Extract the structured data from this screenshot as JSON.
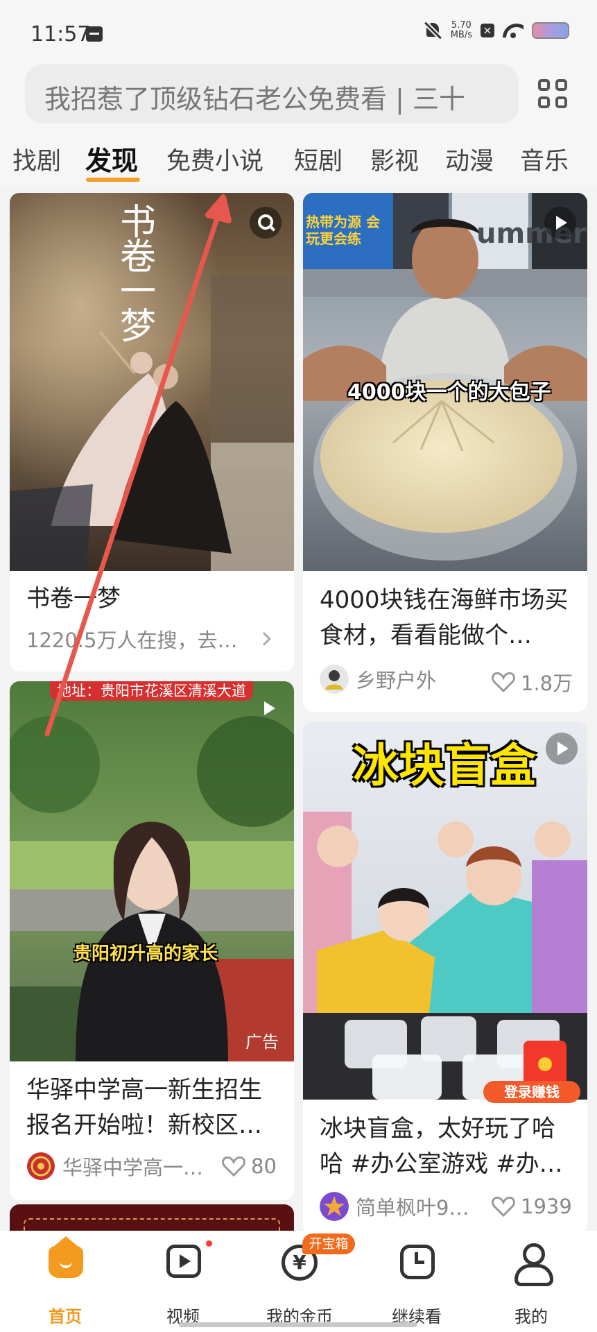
{
  "status_bar": {
    "time": "11:57",
    "net_speed_value": "5.70",
    "net_speed_unit": "MB/s",
    "icons": [
      "message-icon",
      "mute-icon",
      "x-icon",
      "wifi-icon",
      "battery-icon"
    ]
  },
  "search": {
    "placeholder": "我招惹了顶级钻石老公免费看 | 三十"
  },
  "tabs": [
    {
      "label": "找剧"
    },
    {
      "label": "发现"
    },
    {
      "label": "免费小说"
    },
    {
      "label": "短剧"
    },
    {
      "label": "影视"
    },
    {
      "label": "动漫"
    },
    {
      "label": "音乐"
    }
  ],
  "active_tab": "发现",
  "feed": {
    "card1": {
      "poster_title": "书卷一梦",
      "title": "书卷一梦",
      "subtitle": "1220.5万人在搜，去…"
    },
    "card2": {
      "caption": "4000块一个的大包子",
      "banner_text": "热带为源 会玩更会练",
      "sign_text": "ummer",
      "title": "4000块钱在海鲜市场买食材，看看能做个…",
      "author": "乡野户外",
      "likes": "1.8万"
    },
    "card3": {
      "top_banner": "地址：贵阳市花溪区清溪大道",
      "caption": "贵阳初升高的家长",
      "ad_label": "广告",
      "title": "华驿中学高一新生招生报名开始啦！新校区…",
      "author": "华驿中学高一…",
      "likes": "80"
    },
    "card4": {
      "headline": "冰块盲盒",
      "login_badge": "登录赚钱",
      "title": "冰块盲盒，太好玩了哈哈 #办公室游戏 #办…",
      "author": "简单枫叶9…",
      "likes": "1939"
    }
  },
  "bottom_nav": {
    "items": [
      {
        "label": "首页",
        "icon": "home-icon"
      },
      {
        "label": "视频",
        "icon": "video-icon"
      },
      {
        "label": "我的金币",
        "icon": "coin-icon"
      },
      {
        "label": "继续看",
        "icon": "clock-icon"
      },
      {
        "label": "我的",
        "icon": "user-icon"
      }
    ],
    "coin_symbol": "¥",
    "treasure_badge": "开宝箱"
  },
  "colors": {
    "accent": "#f49a1e",
    "background": "#f3f3f3",
    "swipe_arrow": "#e8574d"
  }
}
